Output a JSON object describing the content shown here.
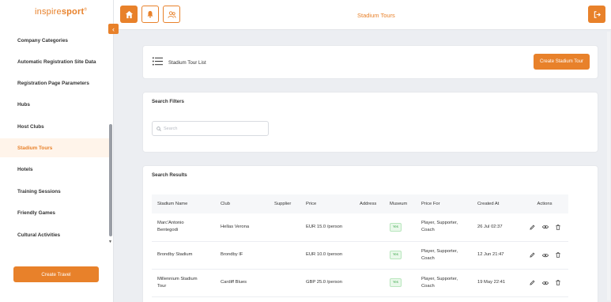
{
  "brand": {
    "part1": "inspire",
    "part2": "sport",
    "mark": "®"
  },
  "sidebar": {
    "items": [
      {
        "label": "Company Categories"
      },
      {
        "label": "Automatic Registration Site Data"
      },
      {
        "label": "Registration Page Parameters"
      },
      {
        "label": "Hubs"
      },
      {
        "label": "Host Clubs"
      },
      {
        "label": "Stadium Tours"
      },
      {
        "label": "Hotels"
      },
      {
        "label": "Training Sessions"
      },
      {
        "label": "Friendly Games"
      },
      {
        "label": "Cultural Activities"
      }
    ],
    "active_index": 5,
    "create_travel_label": "Create Travel"
  },
  "header": {
    "title": "Stadium Tours"
  },
  "list_card": {
    "label": "Stadium Tour List",
    "create_label": "Create Stadium Tour"
  },
  "filters": {
    "heading": "Search Filters",
    "search_placeholder": "Search"
  },
  "results": {
    "heading": "Search Results",
    "columns": [
      "Stadium Name",
      "Club",
      "Supplier",
      "Price",
      "Address",
      "Museum",
      "Price For",
      "Created At",
      "Actions"
    ],
    "rows": [
      {
        "name_line1": "Marc'Antonio",
        "name_line2": "Bentegodi",
        "club": "Hellas Verona",
        "supplier": "",
        "price": "EUR 15.0 /person",
        "address": "",
        "museum": "Yes",
        "price_for_line1": "Player, Supporter,",
        "price_for_line2": "Coach",
        "created_at": "26 Jul 02:37"
      },
      {
        "name_line1": "Brondby Stadium",
        "name_line2": "",
        "club": "Brondby IF",
        "supplier": "",
        "price": "EUR 10.0 /person",
        "address": "",
        "museum": "Yes",
        "price_for_line1": "Player, Supporter,",
        "price_for_line2": "Coach",
        "created_at": "12 Jun 21:47"
      },
      {
        "name_line1": "Millennium Stadium",
        "name_line2": "Tour",
        "club": "Cardiff Blues",
        "supplier": "",
        "price": "GBP 25.0 /person",
        "address": "",
        "museum": "Yes",
        "price_for_line1": "Player, Supporter,",
        "price_for_line2": "Coach",
        "created_at": "19 May 22:41"
      }
    ]
  },
  "icons": {
    "home": "home-icon",
    "bell": "bell-icon",
    "users": "users-icon",
    "logout": "logout-icon",
    "list": "list-icon",
    "search": "search-icon",
    "edit": "edit-icon",
    "view": "eye-icon",
    "delete": "trash-icon"
  },
  "colors": {
    "accent": "#e8812a",
    "active_bg": "#fff4ea",
    "badge_green": "#3aa64a"
  }
}
